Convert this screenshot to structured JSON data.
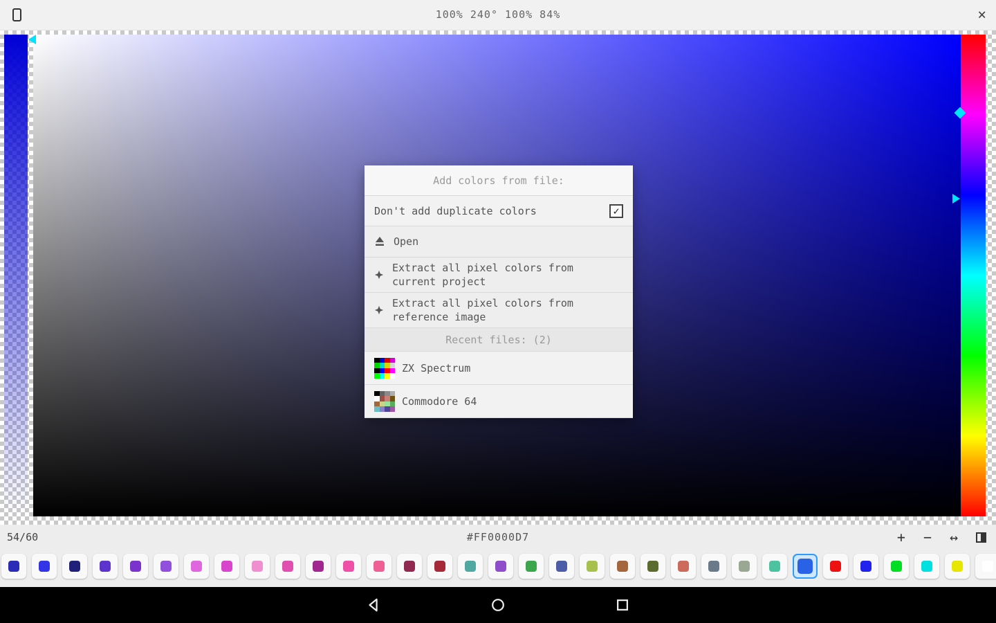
{
  "top_bar": {
    "title": "100% 240° 100% 84%",
    "close": "×"
  },
  "picker": {
    "hue_color": "#0000ff",
    "alpha_top_color": "#0000d6",
    "marker_color": "#00e5ff"
  },
  "dialog": {
    "title": "Add colors from file:",
    "duplicate_label": "Don't add duplicate colors",
    "check_glyph": "✓",
    "open_label": "Open",
    "extract_project_label": "Extract all pixel colors from current project",
    "extract_reference_label": "Extract all pixel colors from reference image",
    "recent_header": "Recent files: (2)",
    "recent_files": [
      {
        "label": "ZX Spectrum"
      },
      {
        "label": "Commodore 64"
      }
    ],
    "zx_palette": [
      "#000000",
      "#0000d7",
      "#d70000",
      "#d700d7",
      "#00d700",
      "#00d7d7",
      "#d7d700",
      "#d7d7d7",
      "#000000",
      "#0000ff",
      "#ff0000",
      "#ff00ff",
      "#00ff00",
      "#00ffff",
      "#ffff00",
      "#ffffff"
    ],
    "c64_palette": [
      "#000000",
      "#626262",
      "#898989",
      "#adadad",
      "#ffffff",
      "#9f4e44",
      "#cb7e75",
      "#6d5412",
      "#a1683c",
      "#c9d487",
      "#9ae29b",
      "#5cab5e",
      "#6abfc6",
      "#887ecb",
      "#50459b",
      "#a057a3"
    ]
  },
  "palette_bar": {
    "counter": "54/60",
    "hex": "#FF0000D7",
    "add": "+",
    "remove": "−",
    "move": "↔",
    "selected_index": 26,
    "swatches": [
      "#2b2bb8",
      "#3333e8",
      "#20207a",
      "#5c33cc",
      "#7a33cc",
      "#9050dd",
      "#e066e0",
      "#d945cc",
      "#ef8fd0",
      "#e04fb0",
      "#a1268f",
      "#f04fa8",
      "#f05f93",
      "#8f2950",
      "#a62939",
      "#4fa8a1",
      "#8f4dcc",
      "#3da64d",
      "#4d5ca6",
      "#a6c24d",
      "#a6663d",
      "#5c6b2e",
      "#cc6b5c",
      "#6b7a8a",
      "#9aa893",
      "#4dc2a1",
      "#2962e6",
      "#ee1111",
      "#2222ee",
      "#00dd22",
      "#00e0e0",
      "#e6e600",
      "#ffffff"
    ]
  },
  "nav_bar": {
    "icons": [
      "back",
      "home",
      "overview"
    ]
  }
}
